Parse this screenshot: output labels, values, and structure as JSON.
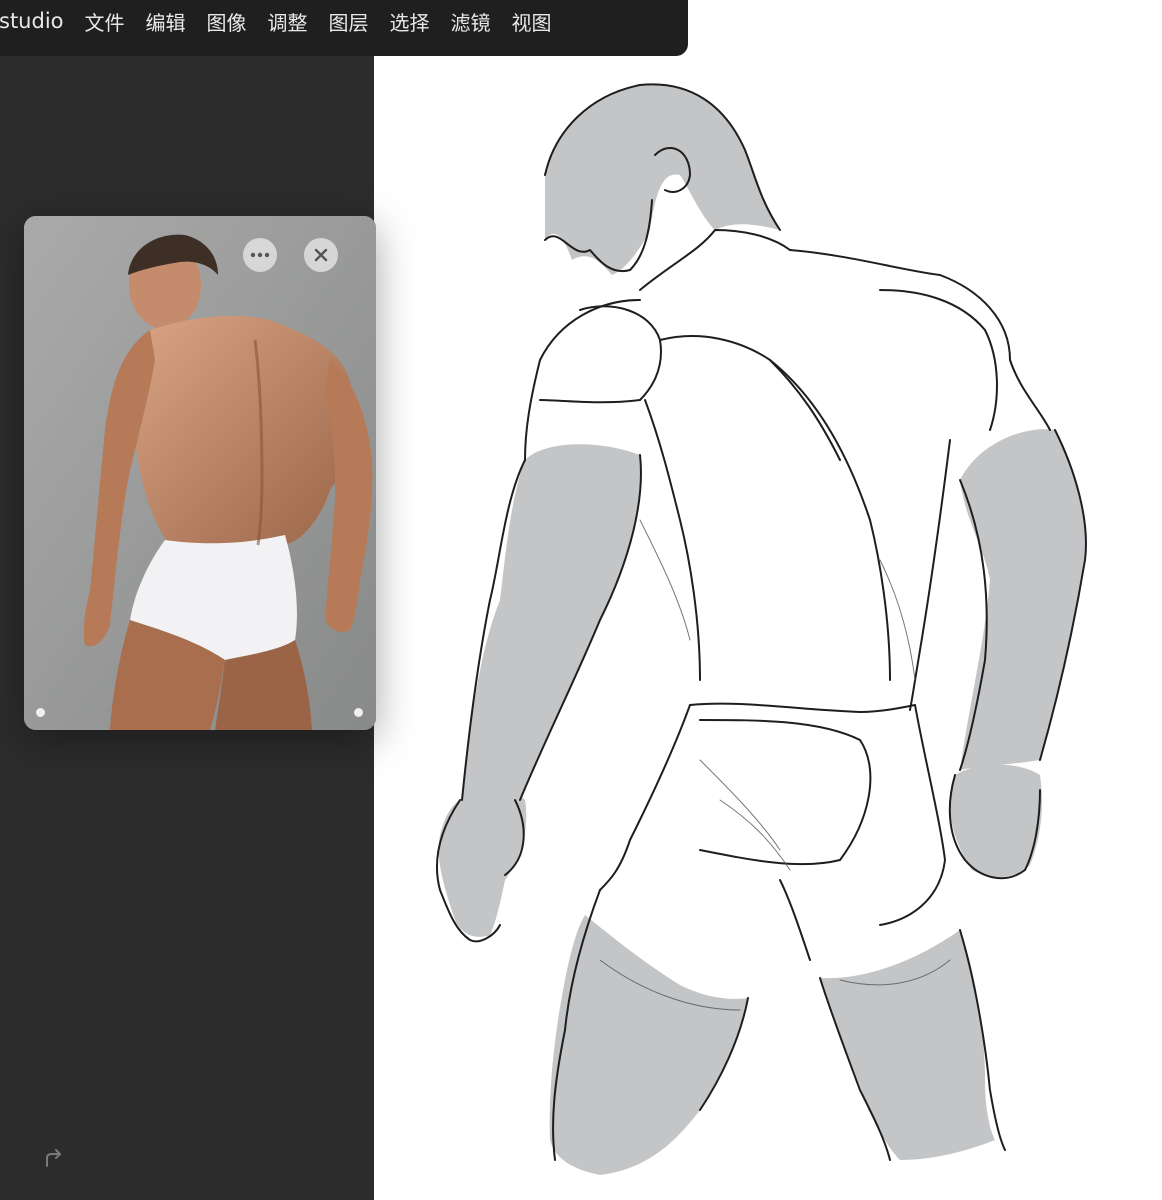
{
  "app": {
    "name": "studio"
  },
  "menu": {
    "items": [
      "文件",
      "编辑",
      "图像",
      "调整",
      "图层",
      "选择",
      "滤镜",
      "视图"
    ]
  },
  "reference": {
    "more_icon": "more-horizontal-icon",
    "close_icon": "close-icon"
  },
  "toolbar": {
    "redo_icon": "redo-icon"
  },
  "colors": {
    "panel": "#2c2c2c",
    "menubar": "#1f1f1f",
    "canvas": "#ffffff",
    "sketch_fill": "#c4c5c7",
    "sketch_line": "#1e1e1e"
  }
}
